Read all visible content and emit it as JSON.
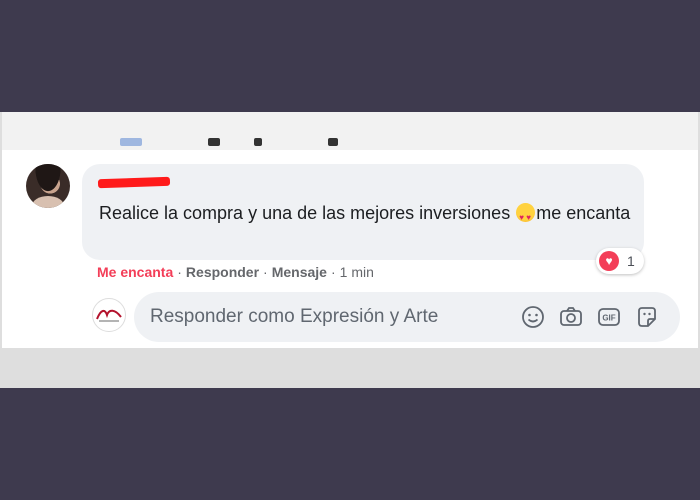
{
  "comment": {
    "text_before_emoji": "Realice la compra y una de las mejores inversiones ",
    "text_after_emoji": "me encanta",
    "emoji": "heart-eyes-emoji"
  },
  "reactions": {
    "icon": "heart-icon",
    "count": "1",
    "color": "#f33e58"
  },
  "actions": {
    "love": "Me encanta",
    "reply": "Responder",
    "message": "Mensaje",
    "separator": "·",
    "time": "1 min"
  },
  "reply_box": {
    "placeholder": "Responder como Expresión y Arte",
    "icons": [
      "emoji-icon",
      "camera-icon",
      "gif-icon",
      "sticker-icon"
    ]
  },
  "colors": {
    "background": "#3e3a4e",
    "bubble": "#eff1f4",
    "accent": "#f33e58",
    "text": "#1c1e21",
    "muted": "#65676b"
  }
}
